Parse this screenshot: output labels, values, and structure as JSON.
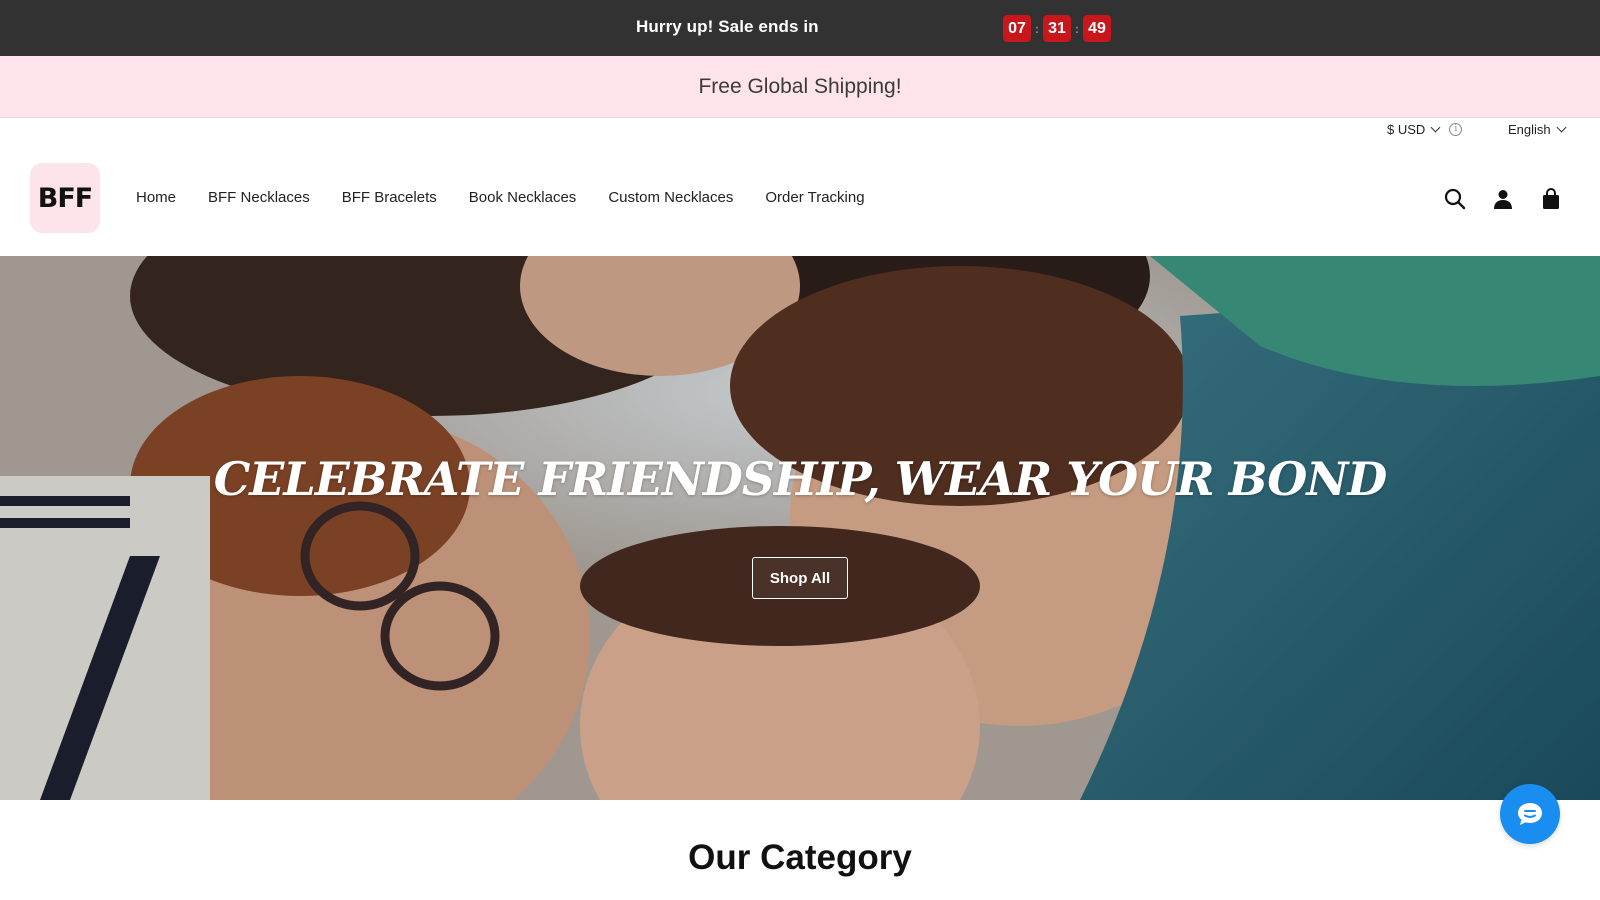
{
  "countdown": {
    "text": "Hurry up! Sale ends in",
    "hours": "07",
    "minutes": "31",
    "seconds": "49",
    "separator": ":"
  },
  "shipping": {
    "text": "Free Global Shipping!"
  },
  "locale": {
    "currency": "$ USD",
    "language": "English"
  },
  "logo": {
    "text": "BFF"
  },
  "nav": {
    "items": [
      "Home",
      "BFF Necklaces",
      "BFF Bracelets",
      "Book Necklaces",
      "Custom Necklaces",
      "Order Tracking"
    ]
  },
  "header_icons": [
    "search-icon",
    "account-icon",
    "cart-icon"
  ],
  "hero": {
    "title": "CELEBRATE FRIENDSHIP, WEAR YOUR BOND",
    "button": "Shop All"
  },
  "section": {
    "title": "Our Category"
  },
  "chat": {
    "icon": "chat-icon"
  },
  "colors": {
    "countdown_bg": "#323232",
    "timer_box": "#c8161d",
    "shipping_bg": "#ffe4ec",
    "logo_bg": "#fde3ea",
    "chat_bg": "#1a8df1"
  }
}
